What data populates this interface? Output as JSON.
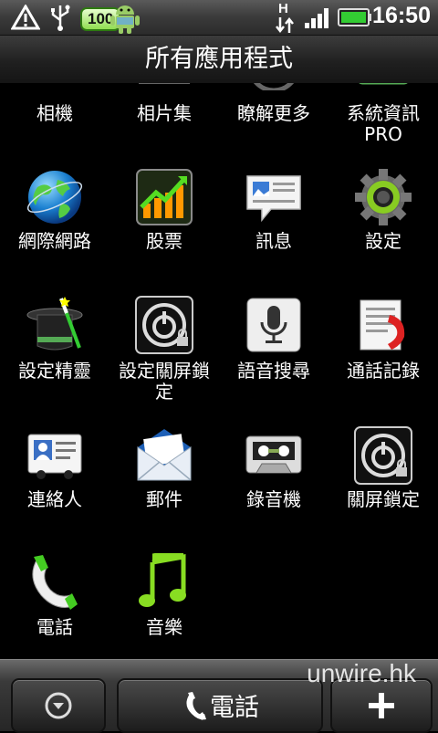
{
  "status_bar": {
    "battery_level": "100",
    "network_type": "H",
    "time": "16:50",
    "icons": [
      "warning-icon",
      "usb-icon",
      "battery-badge",
      "android-icon",
      "network-h-icon",
      "signal-icon",
      "battery-icon"
    ]
  },
  "header": {
    "title": "所有應用程式"
  },
  "apps": [
    {
      "label": "相機",
      "icon": "camera-icon"
    },
    {
      "label": "相片集",
      "icon": "gallery-icon"
    },
    {
      "label": "瞭解更多",
      "icon": "learn-more-icon"
    },
    {
      "label": "系統資訊\nPRO",
      "icon": "system-info-icon"
    },
    {
      "label": "網際網路",
      "icon": "globe-icon"
    },
    {
      "label": "股票",
      "icon": "stocks-icon"
    },
    {
      "label": "訊息",
      "icon": "messages-icon"
    },
    {
      "label": "設定",
      "icon": "settings-gear-icon"
    },
    {
      "label": "設定精靈",
      "icon": "magic-hat-icon"
    },
    {
      "label": "設定關屏鎖\n定",
      "icon": "lock-setting-icon"
    },
    {
      "label": "語音搜尋",
      "icon": "microphone-icon"
    },
    {
      "label": "通話記錄",
      "icon": "call-log-icon"
    },
    {
      "label": "連絡人",
      "icon": "contacts-icon"
    },
    {
      "label": "郵件",
      "icon": "mail-icon"
    },
    {
      "label": "錄音機",
      "icon": "cassette-icon"
    },
    {
      "label": "關屏鎖定",
      "icon": "power-lock-icon"
    },
    {
      "label": "電話",
      "icon": "phone-icon"
    },
    {
      "label": "音樂",
      "icon": "music-note-icon"
    }
  ],
  "dock": {
    "phone_label": "電話",
    "watermark": "unwire.hk"
  }
}
